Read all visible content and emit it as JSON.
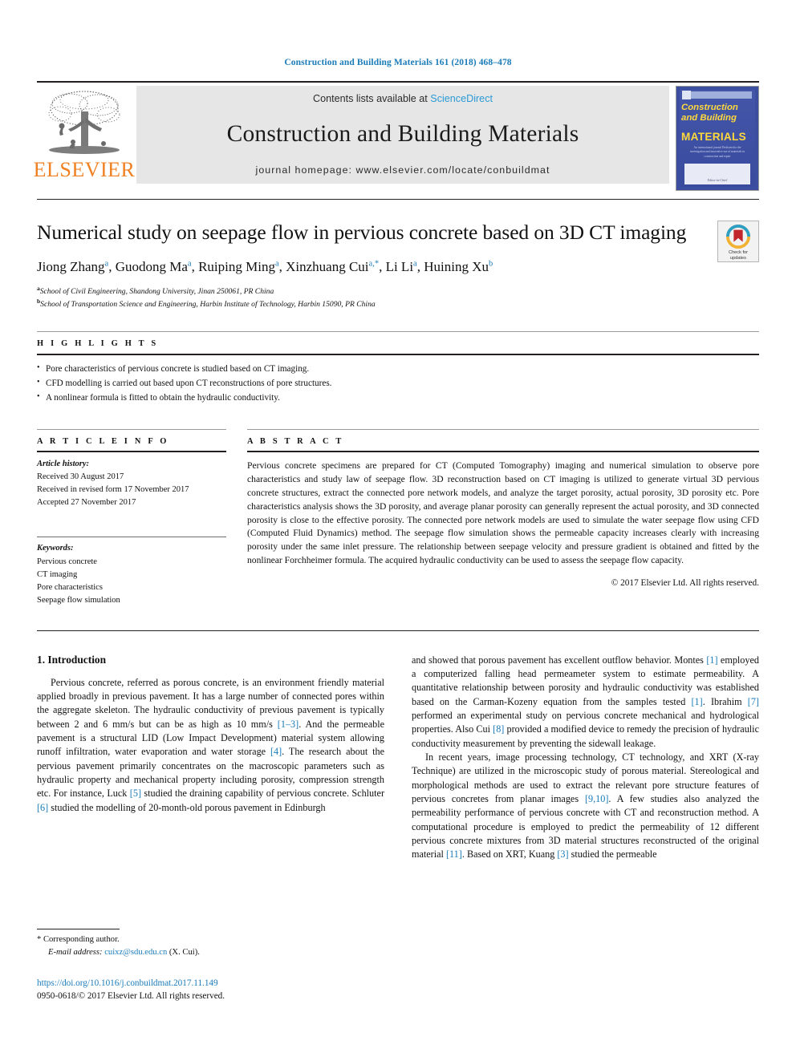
{
  "running_head": "Construction and Building Materials 161 (2018) 468–478",
  "masthead": {
    "publisher_logo_text": "ELSEVIER",
    "contents_prefix": "Contents lists available at ",
    "contents_link": "ScienceDirect",
    "journal_name": "Construction and Building Materials",
    "homepage_line": "journal homepage: www.elsevier.com/locate/conbuildmat",
    "cover": {
      "title_line1": "Construction",
      "title_line2": "and Building",
      "title_line3": "MATERIALS",
      "blurb": "An international journal Dedicated to the investigation and innovative use of materials in construction and repair",
      "footer_note": "Editor-in-Chief"
    }
  },
  "article": {
    "title": "Numerical study on seepage flow in pervious concrete based on 3D CT imaging",
    "crossmark_label_line1": "Check for",
    "crossmark_label_line2": "updates",
    "authors": [
      {
        "name": "Jiong Zhang",
        "marks": "a"
      },
      {
        "name": "Guodong Ma",
        "marks": "a"
      },
      {
        "name": "Ruiping Ming",
        "marks": "a"
      },
      {
        "name": "Xinzhuang Cui",
        "marks": "a,*"
      },
      {
        "name": "Li Li",
        "marks": "a"
      },
      {
        "name": "Huining Xu",
        "marks": "b"
      }
    ],
    "affiliations": [
      {
        "mark": "a",
        "text": "School of Civil Engineering, Shandong University, Jinan 250061, PR China"
      },
      {
        "mark": "b",
        "text": "School of Transportation Science and Engineering, Harbin Institute of Technology, Harbin 15090, PR China"
      }
    ]
  },
  "highlights": {
    "heading": "H I G H L I G H T S",
    "items": [
      "Pore characteristics of pervious concrete is studied based on CT imaging.",
      "CFD modelling is carried out based upon CT reconstructions of pore structures.",
      "A nonlinear formula is fitted to obtain the hydraulic conductivity."
    ]
  },
  "article_info": {
    "heading": "A R T I C L E   I N F O",
    "history_label": "Article history:",
    "history": [
      "Received 30 August 2017",
      "Received in revised form 17 November 2017",
      "Accepted 27 November 2017"
    ],
    "keywords_label": "Keywords:",
    "keywords": [
      "Pervious concrete",
      "CT imaging",
      "Pore characteristics",
      "Seepage flow simulation"
    ]
  },
  "abstract": {
    "heading": "A B S T R A C T",
    "text": "Pervious concrete specimens are prepared for CT (Computed Tomography) imaging and numerical simulation to observe pore characteristics and study law of seepage flow. 3D reconstruction based on CT imaging is utilized to generate virtual 3D pervious concrete structures, extract the connected pore network models, and analyze the target porosity, actual porosity, 3D porosity etc. Pore characteristics analysis shows the 3D porosity, and average planar porosity can generally represent the actual porosity, and 3D connected porosity is close to the effective porosity. The connected pore network models are used to simulate the water seepage flow using CFD (Computed Fluid Dynamics) method. The seepage flow simulation shows the permeable capacity increases clearly with increasing porosity under the same inlet pressure. The relationship between seepage velocity and pressure gradient is obtained and fitted by the nonlinear Forchheimer formula. The acquired hydraulic conductivity can be used to assess the seepage flow capacity.",
    "copyright": "© 2017 Elsevier Ltd. All rights reserved."
  },
  "body": {
    "section_number_title": "1. Introduction",
    "left_paragraph_1": {
      "p1": "Pervious concrete, referred as porous concrete, is an environment friendly material applied broadly in previous pavement. It has a large number of connected pores within the aggregate skeleton. The hydraulic conductivity of previous pavement is typically between 2 and 6 mm/s but can be as high as 10 mm/s ",
      "ref1": "[1–3]",
      "p2": ". And the permeable pavement is a structural LID (Low Impact Development) material system allowing runoff infiltration, water evaporation and water storage ",
      "ref2": "[4]",
      "p3": ". The research about the pervious pavement primarily concentrates on the macroscopic parameters such as hydraulic property and mechanical property including porosity, compression strength etc. For instance, Luck ",
      "ref3": "[5]",
      "p4": " studied the draining capability of pervious concrete. Schluter ",
      "ref4": "[6]",
      "p5": " studied the modelling of 20-month-old porous pavement in Edinburgh"
    },
    "right_paragraph_1": {
      "p1": "and showed that porous pavement has excellent outflow behavior. Montes ",
      "ref1": "[1]",
      "p2": " employed a computerized falling head permeameter system to estimate permeability. A quantitative relationship between porosity and hydraulic conductivity was established based on the Carman-Kozeny equation from the samples tested ",
      "ref2": "[1]",
      "p3": ". Ibrahim ",
      "ref3": "[7]",
      "p4": " performed an experimental study on pervious concrete mechanical and hydrological properties. Also Cui ",
      "ref4": "[8]",
      "p5": " provided a modified device to remedy the precision of hydraulic conductivity measurement by preventing the sidewall leakage."
    },
    "right_paragraph_2": {
      "p1": "In recent years, image processing technology, CT technology, and XRT (X-ray Technique) are utilized in the microscopic study of porous material. Stereological and morphological methods are used to extract the relevant pore structure features of pervious concretes from planar images ",
      "ref1": "[9,10]",
      "p2": ". A few studies also analyzed the permeability performance of pervious concrete with CT and reconstruction method. A computational procedure is employed to predict the permeability of 12 different pervious concrete mixtures from 3D material structures reconstructed of the original material ",
      "ref2": "[11]",
      "p3": ". Based on XRT, Kuang ",
      "ref3": "[3]",
      "p4": " studied the permeable"
    }
  },
  "footnote": {
    "corresponding": "* Corresponding author.",
    "email_label": "E-mail address:",
    "email": "cuixz@sdu.edu.cn",
    "email_suffix": "(X. Cui)."
  },
  "footer": {
    "doi": "https://doi.org/10.1016/j.conbuildmat.2017.11.149",
    "issn_line": "0950-0618/© 2017 Elsevier Ltd. All rights reserved."
  },
  "colors": {
    "link_blue": "#1a7bb9",
    "sciencedirect_blue": "#2b9ad6",
    "elsevier_orange": "#f08122",
    "band_gray": "#e6e6e6",
    "cover_blue": "#3b4ea0",
    "cover_yellow": "#ffd83c"
  }
}
